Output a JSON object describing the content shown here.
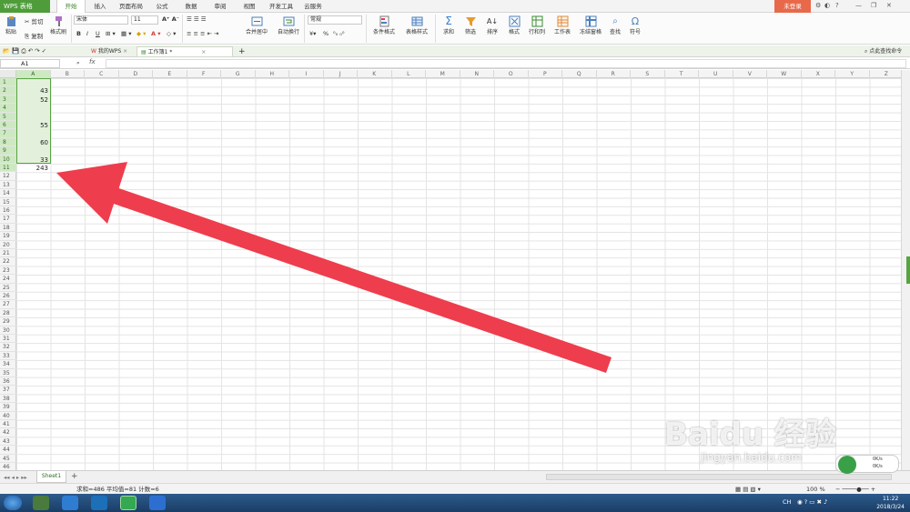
{
  "app": {
    "name": "WPS 表格",
    "login": "未登录"
  },
  "menu_tabs": [
    "开始",
    "插入",
    "页面布局",
    "公式",
    "数据",
    "审阅",
    "视图",
    "开发工具",
    "云服务"
  ],
  "ribbon": {
    "paste": "粘贴",
    "cut": "剪切",
    "copy": "复制",
    "format_painter": "格式刷",
    "font_name": "宋体",
    "font_size": "11",
    "bold": "B",
    "italic": "I",
    "underline": "U",
    "merge_center": "合并居中",
    "wrap_text": "自动换行",
    "number_format": "常规",
    "percent": "%",
    "cond_format": "条件格式",
    "table_style": "表格样式",
    "sum": "求和",
    "filter": "筛选",
    "sort": "排序",
    "format": "格式",
    "rows_cols": "行和列",
    "worksheet": "工作表",
    "freeze": "冻结窗格",
    "find": "查找",
    "symbol": "符号"
  },
  "doc_tabs": {
    "mywps": "我的WPS",
    "workbook": "工作簿1 *",
    "find_command": "点此查找命令"
  },
  "formula_bar": {
    "cell_ref": "A1",
    "fx": "fx"
  },
  "columns": [
    "A",
    "B",
    "C",
    "D",
    "E",
    "F",
    "G",
    "H",
    "I",
    "J",
    "K",
    "L",
    "M",
    "N",
    "O",
    "P",
    "Q",
    "R",
    "S",
    "T",
    "U",
    "V",
    "W",
    "X",
    "Y",
    "Z"
  ],
  "rows": [
    "1",
    "2",
    "3",
    "4",
    "5",
    "6",
    "7",
    "8",
    "9",
    "10",
    "11",
    "12",
    "13",
    "14",
    "15",
    "16",
    "17",
    "18",
    "19",
    "20",
    "21",
    "22",
    "23",
    "24",
    "25",
    "26",
    "27",
    "28",
    "29",
    "30",
    "31",
    "32",
    "33",
    "34",
    "35",
    "36",
    "37",
    "38",
    "39",
    "40",
    "41",
    "42",
    "43",
    "44",
    "45",
    "46"
  ],
  "cell_values": [
    {
      "row": "2",
      "value": "43"
    },
    {
      "row": "3",
      "value": "52"
    },
    {
      "row": "6",
      "value": "55"
    },
    {
      "row": "8",
      "value": "60"
    },
    {
      "row": "10",
      "value": "33"
    },
    {
      "row": "11",
      "value": "243"
    }
  ],
  "sheet_tab": "Sheet1",
  "status": {
    "summary": "求和=486  平均值=81  计数=6",
    "zoom": "100 %"
  },
  "taskbar": {
    "time": "11:22",
    "date": "2018/3/24",
    "lang": "CH"
  },
  "watermark": {
    "brand": "Baidu 经验",
    "url": "jingyan.baidu.com"
  },
  "net": {
    "up": "0K/s",
    "down": "0K/s"
  },
  "colors": {
    "accent": "#4f9d3a",
    "selection_fill": "#e3f1dc",
    "arrow": "#ee3d4c",
    "login": "#e8694a"
  }
}
